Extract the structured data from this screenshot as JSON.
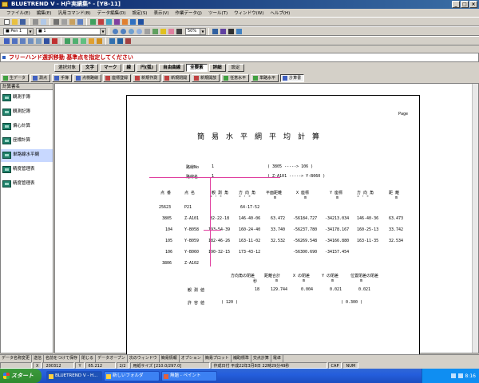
{
  "window": {
    "title": "BLUETREND V - H户実績集* - [YB-11]",
    "controls": [
      "_",
      "□",
      "×"
    ]
  },
  "menu": [
    "ファイル(E)",
    "編集(E)",
    "汎用コマンド(B)",
    "データ編集(D)",
    "設定(S)",
    "表示(V)",
    "作業データ(J)",
    "ツール(T)",
    "ウィンドウ(W)",
    "ヘルプ(H)"
  ],
  "toolbar": {
    "pen_combo": "■ Pen 1",
    "line_combo": "■ 1",
    "zoom_level": "50%"
  },
  "prompt": "フリーハンド選択移動 基準点を指定してください",
  "commands": [
    {
      "label": "選択対象",
      "active": false,
      "bold": false
    },
    {
      "label": "文字",
      "active": false,
      "bold": true
    },
    {
      "label": "マーク",
      "active": false,
      "bold": true
    },
    {
      "label": "線",
      "active": false,
      "bold": true
    },
    {
      "label": "円(弧)",
      "active": false,
      "bold": true
    },
    {
      "label": "自由曲線",
      "active": false,
      "bold": true
    },
    {
      "label": "全要素",
      "active": true,
      "bold": true
    },
    {
      "label": "詳細",
      "active": false,
      "bold": true
    },
    {
      "label": "設定",
      "active": false,
      "bold": false
    }
  ],
  "tabs": [
    {
      "label": "生データ",
      "color": "#40a040"
    },
    {
      "label": "測点",
      "color": "#4060c0"
    },
    {
      "label": "手簿",
      "color": "#4060c0"
    },
    {
      "label": "点検路線",
      "color": "#4060c0"
    },
    {
      "label": "座標登録",
      "color": "#c04040"
    },
    {
      "label": "新規作測",
      "color": "#c04040"
    },
    {
      "label": "新規閉開",
      "color": "#c04040"
    },
    {
      "label": "新規開放",
      "color": "#c04040"
    },
    {
      "label": "任意水平",
      "color": "#40a040"
    },
    {
      "label": "単路水平",
      "color": "#40a040"
    },
    {
      "label": "計算書",
      "color": "#4060c0",
      "active": true
    }
  ],
  "left_panel": {
    "header": "計算書名",
    "items": [
      {
        "label": "観測手簿"
      },
      {
        "label": "観測記簿"
      },
      {
        "label": "偏心計算"
      },
      {
        "label": "座標計算"
      },
      {
        "label": "単路線水平網",
        "selected": true
      },
      {
        "label": "精度管理表"
      },
      {
        "label": "精度管理表"
      }
    ]
  },
  "document": {
    "page_label": "Page",
    "title": "簡易水平網平均計算",
    "route_no_label": "路線No",
    "route_no_value": "1",
    "route_name_label": "路線名",
    "route_name_value": "1",
    "route_line1": "(      3805    ----->          106 )",
    "route_line2": "(  Z-A101    ----->    Y-B060     )",
    "headers": {
      "no": "点 番",
      "name": "点 名",
      "obs_angle": "観 測 角",
      "direction": "方 向 角",
      "horiz_dist": "平面距離",
      "x_coord": "X 座標",
      "y_coord": "Y 座標",
      "direction2": "方 向 角",
      "distance": "距 離"
    },
    "units": {
      "obs_angle": "°  '  \"",
      "direction": "°  '  \"",
      "horiz_dist": "m",
      "x_coord": "m",
      "y_coord": "m",
      "direction2": "°  '  \"",
      "distance": "m"
    },
    "rows": [
      {
        "no": "25623",
        "name": "P21",
        "obs": "",
        "dir": "64-17-52",
        "hd": "",
        "x": "",
        "y": "",
        "dir2": "",
        "dist": ""
      },
      {
        "no": "3805",
        "name": "Z-A101",
        "obs": "82-22-18",
        "dir": "146-40-06",
        "hd": "63.472",
        "x": "-56184.727",
        "y": "-34213.034",
        "dir2": "146-40-36",
        "dist": "63.473"
      },
      {
        "no": "104",
        "name": "Y-B058",
        "obs": "193-54-39",
        "dir": "160-24-40",
        "hd": "33.740",
        "x": "-56237.780",
        "y": "-34178.167",
        "dir2": "160-25-13",
        "dist": "33.742"
      },
      {
        "no": "105",
        "name": "Y-B059",
        "obs": "182-46-26",
        "dir": "163-11-02",
        "hd": "32.532",
        "x": "-56269.548",
        "y": "-34166.880",
        "dir2": "163-11-35",
        "dist": "32.534"
      },
      {
        "no": "106",
        "name": "Y-B060",
        "obs": "190-32-15",
        "dir": "173-43-12",
        "hd": "",
        "x": "-56300.690",
        "y": "-34157.454",
        "dir2": "",
        "dist": ""
      },
      {
        "no": "3806",
        "name": "Z-A102",
        "obs": "",
        "dir": "",
        "hd": "",
        "x": "",
        "y": "",
        "dir2": "",
        "dist": ""
      }
    ],
    "summary_headers": {
      "dir_err": "方向角の閉差",
      "dir_err_unit": "秒",
      "dist_total": "距離合計",
      "dist_total_unit": "m",
      "x_err": "X の閉差",
      "x_err_unit": "m",
      "y_err": "Y の閉差",
      "y_err_unit": "m",
      "pos_err": "位置閉差の閉差",
      "pos_err_unit": "m"
    },
    "observed": {
      "label": "観 測 値",
      "dir_err": "18",
      "dist_total": "129.744",
      "x_err": "0.004",
      "y_err": "0.021",
      "pos_err": "0.021"
    },
    "allowed": {
      "label": "許 容 値",
      "dir_err": "(        120 )",
      "pos_err": "(       0.300 )"
    }
  },
  "bottom_bar": [
    "データ名称変更",
    "送信",
    "名前をつけて保存",
    "閉じる",
    "データオープン",
    "次のウィンドウ",
    "簡易情報",
    "オプション",
    "簡易プロット",
    "補助標準",
    "交点計算",
    "電卓"
  ],
  "status": {
    "x_label": "X",
    "x_value": "200312",
    "y_label": "Y",
    "y_value": "65.212",
    "page": "2/2",
    "paper": "用紙サイズ [210.0/297.0]",
    "date": "作成日付 平成22年3月8日 22時29分49秒",
    "caps": "CAP",
    "num": "NUM"
  },
  "taskbar": {
    "start": "スタート",
    "tasks": [
      {
        "label": "BLUETREND V - H...",
        "active": true
      },
      {
        "label": "新しいフォルダ",
        "active": false
      },
      {
        "label": "無題 - ペイント",
        "active": false
      }
    ],
    "clock": "8:16"
  }
}
